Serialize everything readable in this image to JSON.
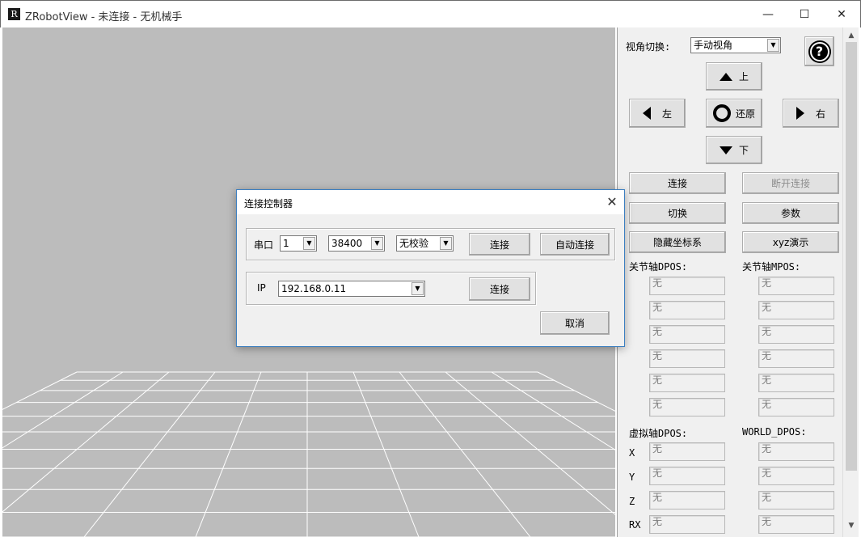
{
  "window": {
    "title": "ZRobotView - 未连接 - 无机械手",
    "app_icon_letter": "R",
    "minimize_glyph": "—",
    "maximize_glyph": "☐",
    "close_glyph": "✕"
  },
  "panel": {
    "view_switch_label": "视角切换:",
    "view_mode": "手动视角",
    "help_glyph": "?",
    "nav": {
      "up": "上",
      "left": "左",
      "reset": "还原",
      "right": "右",
      "down": "下"
    },
    "buttons": {
      "connect": "连接",
      "disconnect": "断开连接",
      "switch": "切换",
      "params": "参数",
      "hide_axes": "隐藏坐标系",
      "xyz_demo": "xyz演示"
    },
    "joint_dpos_label": "关节轴DPOS:",
    "joint_mpos_label": "关节轴MPOS:",
    "joint_dpos": [
      "无",
      "无",
      "无",
      "无",
      "无",
      "无"
    ],
    "joint_mpos": [
      "无",
      "无",
      "无",
      "无",
      "无",
      "无"
    ],
    "virtual_dpos_label": "虚拟轴DPOS:",
    "world_dpos_label": "WORLD_DPOS:",
    "axis_labels": [
      "X",
      "Y",
      "Z",
      "RX"
    ],
    "virtual_dpos": [
      "无",
      "无",
      "无",
      "无"
    ],
    "world_dpos": [
      "无",
      "无",
      "无",
      "无"
    ]
  },
  "dialog": {
    "title": "连接控制器",
    "close_glyph": "✕",
    "serial_label": "串口",
    "serial_port": "1",
    "baud_rate": "38400",
    "parity": "无校验",
    "serial_connect": "连接",
    "auto_connect": "自动连接",
    "ip_label": "IP",
    "ip_value": "192.168.0.11",
    "ip_connect": "连接",
    "cancel": "取消"
  },
  "colors": {
    "viewport_bg": "#bcbcbc",
    "grid_line": "#ffffff",
    "panel_bg": "#f0f0f0",
    "dialog_border": "#3c7fc1"
  }
}
